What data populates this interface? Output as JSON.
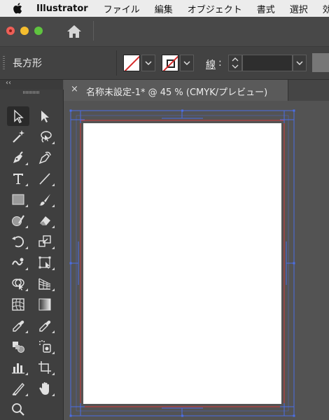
{
  "menubar": {
    "app_name": "Illustrator",
    "items": [
      "ファイル",
      "編集",
      "オブジェクト",
      "書式",
      "選択",
      "効果"
    ]
  },
  "window": {
    "icons": [
      "close-icon",
      "minimize-icon",
      "zoom-icon",
      "home-icon"
    ]
  },
  "control_bar": {
    "tool_name": "長方形",
    "stroke_label": "線",
    "stroke_colon": ":",
    "stroke_width_value": ""
  },
  "document": {
    "tab_close": "×",
    "tab_title": "名称未設定-1* @ 45 % (CMYK/プレビュー)"
  },
  "tools_panel": {
    "collapse_label": "‹‹",
    "selected_tool": "selection-tool"
  },
  "colors": {
    "menubar_bg": "#ececec",
    "ui_dark": "#424242",
    "canvas_bg": "#535353",
    "artboard": "#ffffff",
    "bleed_guide": "#d23b3b",
    "selection_blue": "#4b6ee6"
  }
}
